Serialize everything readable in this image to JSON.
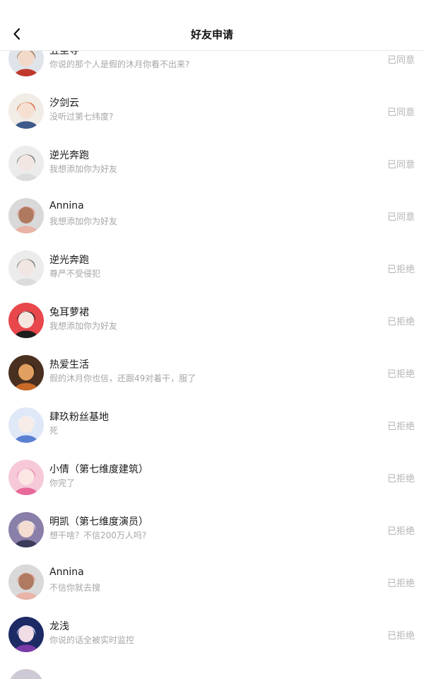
{
  "header": {
    "title": "好友申请",
    "back_icon": "chevron-left-icon"
  },
  "requests": [
    {
      "name": "五尘寺",
      "message": "你说的那个人是假的沐月你看不出来?",
      "status": "已同意",
      "avatar": {
        "bg": "#dfe4ea",
        "hair": "#a8765a",
        "skin": "#f3d9c8",
        "cloth": "#c0392b"
      }
    },
    {
      "name": "汐剑云",
      "message": "没听过第七纬度?",
      "status": "已同意",
      "avatar": {
        "bg": "#f1ece6",
        "hair": "#d96a3a",
        "skin": "#f6e0d2",
        "cloth": "#3d5a8a"
      }
    },
    {
      "name": "逆光奔跑",
      "message": "我想添加你为好友",
      "status": "已同意",
      "avatar": {
        "bg": "#ececec",
        "hair": "#7a7a7a",
        "skin": "#f2e6e2",
        "cloth": "#dcdcdc"
      }
    },
    {
      "name": "Annina",
      "message": "我想添加你为好友",
      "status": "已同意",
      "avatar": {
        "bg": "#d9d9d9",
        "hair": "#e49a8e",
        "skin": "#b07a60",
        "cloth": "#e8b4a8"
      }
    },
    {
      "name": "逆光奔跑",
      "message": "尊严不受侵犯",
      "status": "已拒绝",
      "avatar": {
        "bg": "#ececec",
        "hair": "#7a7a7a",
        "skin": "#f2e6e2",
        "cloth": "#dcdcdc"
      }
    },
    {
      "name": "兔耳萝裙",
      "message": "我想添加你为好友",
      "status": "已拒绝",
      "avatar": {
        "bg": "#e8474c",
        "hair": "#2b2b2b",
        "skin": "#f5e6e0",
        "cloth": "#1e1e1e"
      }
    },
    {
      "name": "热爱生活",
      "message": "假的沐月你也信，还跟49对着干，服了",
      "status": "已拒绝",
      "avatar": {
        "bg": "#4a3020",
        "hair": "#2a1a10",
        "skin": "#e2a060",
        "cloth": "#c86a28"
      }
    },
    {
      "name": "肆玖粉丝基地",
      "message": "死",
      "status": "已拒绝",
      "avatar": {
        "bg": "#dfe8f7",
        "hair": "#f2f5fb",
        "skin": "#f7ece8",
        "cloth": "#5b7fd1"
      }
    },
    {
      "name": "小倩（第七维度建筑）",
      "message": "你完了",
      "status": "已拒绝",
      "avatar": {
        "bg": "#f6c8d8",
        "hair": "#f08db0",
        "skin": "#fbe6e4",
        "cloth": "#e86a9a"
      }
    },
    {
      "name": "明凯（第七维度演员）",
      "message": "想干啥？不信200万人吗?",
      "status": "已拒绝",
      "avatar": {
        "bg": "#8a7fa8",
        "hair": "#f2f2f2",
        "skin": "#f3ddd0",
        "cloth": "#3a3a5a"
      }
    },
    {
      "name": "Annina",
      "message": "不信你就去搜",
      "status": "已拒绝",
      "avatar": {
        "bg": "#d9d9d9",
        "hair": "#e49a8e",
        "skin": "#b07a60",
        "cloth": "#e8b4a8"
      }
    },
    {
      "name": "龙浅",
      "message": "你说的话全被实时监控",
      "status": "已拒绝",
      "avatar": {
        "bg": "#1c2a66",
        "hair": "#d8d8ff",
        "skin": "#f1dde6",
        "cloth": "#7a3aa8"
      }
    }
  ],
  "peek_avatar": {
    "bg": "#cfc9d6"
  }
}
